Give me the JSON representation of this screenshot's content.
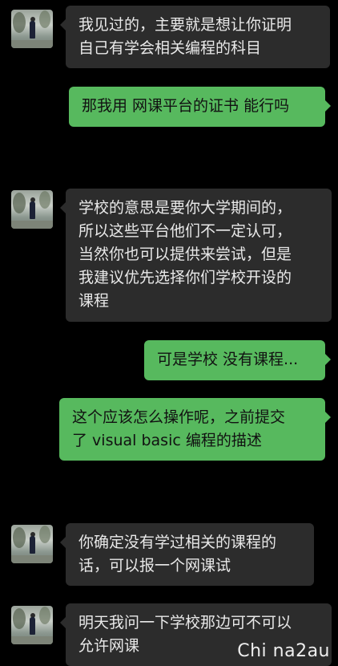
{
  "conversation": {
    "messages": [
      {
        "side": "left",
        "text": "我见过的，主要就是想让你证明\n自己有学会相关编程的科目"
      },
      {
        "side": "right",
        "text": "那我用 网课平台的证书 能行吗"
      },
      {
        "side": "left",
        "text": "学校的意思是要你大学期间的，\n所以这些平台他们不一定认可，\n当然你也可以提供来尝试，但是\n我建议优先选择你们学校开设的\n课程"
      },
      {
        "side": "right",
        "text": "可是学校 没有课程..."
      },
      {
        "side": "right",
        "text": "这个应该怎么操作呢，之前提交\n了 visual basic 编程的描述"
      },
      {
        "side": "left",
        "text": "你确定没有学过相关的课程的\n话，可以报一个网课试"
      },
      {
        "side": "left",
        "text": "明天我问一下学校那边可不可以\n允许网课"
      }
    ]
  },
  "watermark": "Chi na2au"
}
